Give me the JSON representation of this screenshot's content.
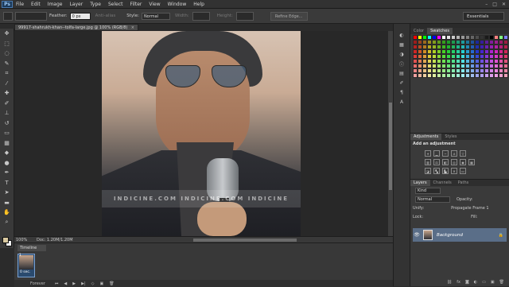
{
  "app": {
    "logo": "Ps"
  },
  "menu": [
    "File",
    "Edit",
    "Image",
    "Layer",
    "Type",
    "Select",
    "Filter",
    "View",
    "Window",
    "Help"
  ],
  "window_controls": [
    "–",
    "□",
    "✕"
  ],
  "options": {
    "feather_label": "Feather:",
    "feather_value": "0 px",
    "antialias_label": "Anti-alias",
    "style_label": "Style:",
    "style_value": "Normal",
    "width_label": "Width:",
    "height_label": "Height:",
    "refine_edge": "Refine Edge..."
  },
  "workspace": "Essentials",
  "document": {
    "tab_title": "99917-shahrukh-khan--tolfa-large.jpg @ 100% (RGB/8)",
    "close": "×",
    "watermark": "INDICINE.COM INDICINE.COM INDICINE"
  },
  "status": {
    "zoom": "100%",
    "doc": "Doc: 1.20M/1.20M"
  },
  "timeline": {
    "title": "Timeline",
    "frame_number": "1",
    "frame_delay": "0 sec.",
    "loop": "Forever",
    "controls": [
      "⏮",
      "◀",
      "▶",
      "▶|",
      "◇",
      "▣",
      "🗑"
    ]
  },
  "right_strip_icons": [
    "color-panel-icon",
    "swatches-icon",
    "adjust-icon",
    "info-icon",
    "history-icon",
    "brush-icon",
    "paragraph-icon",
    "character-icon"
  ],
  "color_panel": {
    "tabs": [
      "Color",
      "Swatches"
    ],
    "active": "Swatches"
  },
  "adjustments": {
    "tabs": [
      "Adjustments",
      "Styles"
    ],
    "title": "Add an adjustment"
  },
  "layers": {
    "tabs": [
      "Layers",
      "Channels",
      "Paths"
    ],
    "kind_label": "Kind",
    "blend_mode": "Normal",
    "opacity_label": "Opacity:",
    "unify_label": "Unify:",
    "propagate_label": "Propagate Frame 1",
    "lock_label": "Lock:",
    "fill_label": "Fill:",
    "layer_name": "Background"
  },
  "colors": {
    "accent": "#5a6e88",
    "bg": "#2b2b2b"
  }
}
